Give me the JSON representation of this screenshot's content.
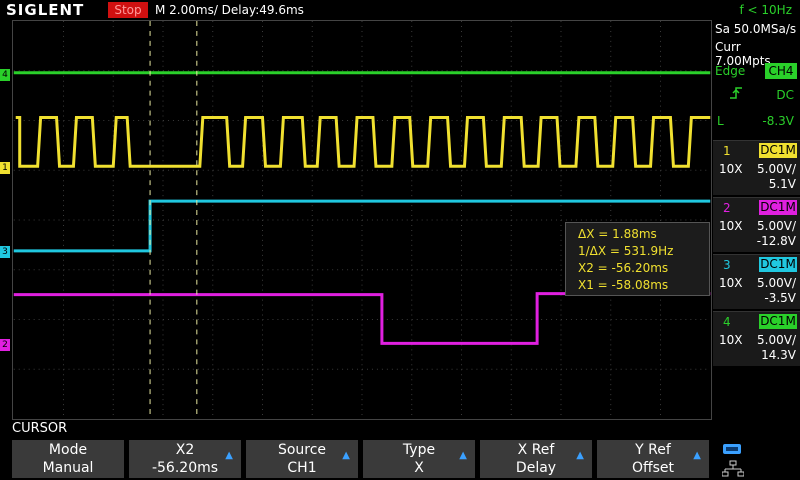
{
  "header": {
    "brand": "SIGLENT",
    "run_state": "Stop",
    "timebase": "M 2.00ms/ Delay:49.6ms",
    "frequency": "f < 10Hz"
  },
  "acquisition": {
    "sample_rate": "Sa 50.0MSa/s",
    "memory_depth": "Curr 7.00Mpts"
  },
  "trigger": {
    "type": "Edge",
    "source": "CH4",
    "coupling": "DC",
    "level_label": "L",
    "level": "-8.3V"
  },
  "channels": [
    {
      "num": "1",
      "coupling": "DC1M",
      "probe": "10X",
      "scale": "5.00V/",
      "offset": "5.1V",
      "color": "#f0e030"
    },
    {
      "num": "2",
      "coupling": "DC1M",
      "probe": "10X",
      "scale": "5.00V/",
      "offset": "-12.8V",
      "color": "#e020e0"
    },
    {
      "num": "3",
      "coupling": "DC1M",
      "probe": "10X",
      "scale": "5.00V/",
      "offset": "-3.5V",
      "color": "#20c8e0"
    },
    {
      "num": "4",
      "coupling": "DC1M",
      "probe": "10X",
      "scale": "5.00V/",
      "offset": "14.3V",
      "color": "#2ad02a"
    }
  ],
  "markers": {
    "ch1": "1",
    "ch2": "2",
    "ch3": "3",
    "ch4": "4"
  },
  "cursor_readout": {
    "dx": "ΔX = 1.88ms",
    "inv_dx": "1/ΔX = 531.9Hz",
    "x2": "X2 = -56.20ms",
    "x1": "X1 = -58.08ms"
  },
  "menu": {
    "title": "CURSOR",
    "softkeys": [
      {
        "label": "Mode",
        "value": "Manual",
        "arrow": false
      },
      {
        "label": "X2",
        "value": "-56.20ms",
        "arrow": true
      },
      {
        "label": "Source",
        "value": "CH1",
        "arrow": true
      },
      {
        "label": "Type",
        "value": "X",
        "arrow": true
      },
      {
        "label": "X Ref",
        "value": "Delay",
        "arrow": true
      },
      {
        "label": "Y Ref",
        "value": "Offset",
        "arrow": true
      }
    ]
  },
  "icons": {
    "arrow": "▲",
    "trigger_edge": "rising-edge-icon",
    "usb": "usb-icon",
    "network": "network-icon"
  }
}
